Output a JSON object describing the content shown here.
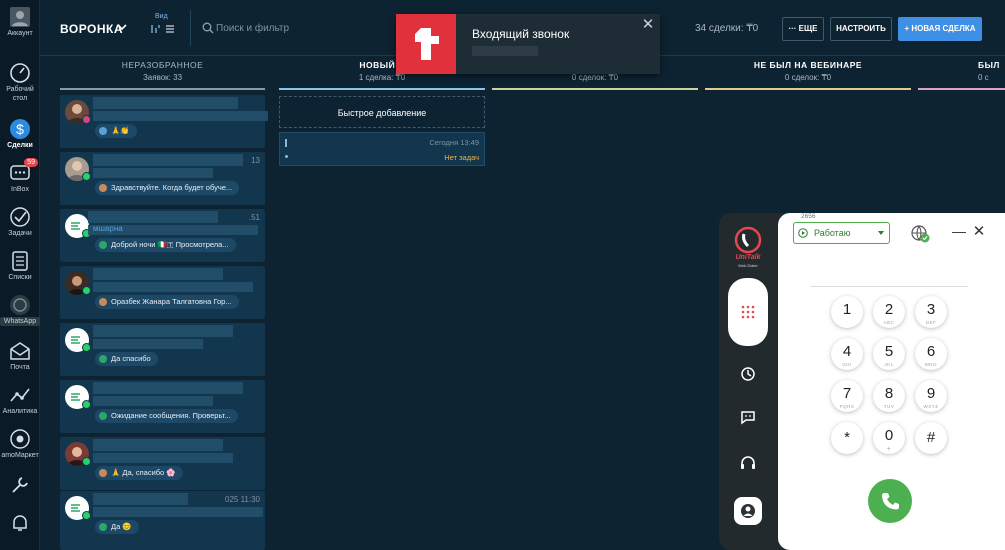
{
  "sidebar": {
    "items": [
      {
        "label": "Аккаунт",
        "icon": "account-icon"
      },
      {
        "label": "Рабочий стол",
        "icon": "dashboard-icon"
      },
      {
        "label": "Сделки",
        "icon": "deals-icon"
      },
      {
        "label": "InBox",
        "icon": "inbox-icon",
        "badge": "59"
      },
      {
        "label": "Задачи",
        "icon": "tasks-icon"
      },
      {
        "label": "Списки",
        "icon": "lists-icon"
      },
      {
        "label": "WhatsApp",
        "icon": "whatsapp-icon"
      },
      {
        "label": "Почта",
        "icon": "mail-icon"
      },
      {
        "label": "Аналитика",
        "icon": "analytics-icon"
      },
      {
        "label": "amoМаркет",
        "icon": "market-icon"
      }
    ]
  },
  "header": {
    "pipeline": "ВОРОНКА",
    "view_label": "Вид",
    "search_placeholder": "Поиск и фильтр",
    "deal_count": "34 сделки: ₸0",
    "more_label": "··· ЕЩЕ",
    "setup_label": "НАСТРОИТЬ",
    "new_deal_label": "+ НОВАЯ СДЕЛКА"
  },
  "columns": [
    {
      "title": "НЕРАЗОБРАННОЕ",
      "sub": "Заявок: 33",
      "color": "#8b9aa6"
    },
    {
      "title": "НОВЫЙ Л",
      "sub": "1 сделка: ₸0",
      "color": "#8cc4ea"
    },
    {
      "title": "",
      "sub": "0 сделок: ₸0",
      "color": "#c9d49a"
    },
    {
      "title": "НЕ БЫЛ НА ВЕБИНАРЕ",
      "sub": "0 сделок: ₸0",
      "color": "#e2c98d"
    },
    {
      "title": "БЫЛ",
      "sub": "0 с",
      "color": "#d6a5c8"
    }
  ],
  "leads": [
    {
      "message": "🙏👏",
      "time": ""
    },
    {
      "message": "Здравствуйте. Когда будет обуче...",
      "time": "13"
    },
    {
      "message": "Доброй ночи 🇮🇹🇹 Просмотрела...",
      "time": ".51",
      "name_fragment": "мшарна"
    },
    {
      "message": "Оразбек Жанара Талгатовна Гор...",
      "time": ""
    },
    {
      "message": "Да спасибо",
      "time": ""
    },
    {
      "message": "Ожидание сообщения. Проверьт...",
      "time": ""
    },
    {
      "message": "🙏 Да, спасибо 🌸",
      "time": ""
    },
    {
      "message": "Да 😊",
      "time": "025 11:30"
    }
  ],
  "new_column": {
    "quick_add": "Быстрое добавление",
    "deal_time": "Сегодня 13:49",
    "deal_task": "Нет задач"
  },
  "notification": {
    "title": "Входящий звонок",
    "close": "✕"
  },
  "dialer": {
    "brand": "UniTalk",
    "brand_sub": "Web Dialer",
    "extension": "2656",
    "status": "Работаю",
    "minimize": "—",
    "close": "✕",
    "keys": [
      {
        "digit": "1",
        "letters": ""
      },
      {
        "digit": "2",
        "letters": "ABC"
      },
      {
        "digit": "3",
        "letters": "DEF"
      },
      {
        "digit": "4",
        "letters": "GHI"
      },
      {
        "digit": "5",
        "letters": "JKL"
      },
      {
        "digit": "6",
        "letters": "MNO"
      },
      {
        "digit": "7",
        "letters": "PQRS"
      },
      {
        "digit": "8",
        "letters": "TUV"
      },
      {
        "digit": "9",
        "letters": "WXYZ"
      },
      {
        "digit": "*",
        "letters": ""
      },
      {
        "digit": "0",
        "letters": "+"
      },
      {
        "digit": "#",
        "letters": ""
      }
    ]
  },
  "colors": {
    "accent": "#3f8fe6",
    "background": "#0d2332",
    "card": "#12364d",
    "notification_brand": "#e1313c",
    "call_green": "#4caf50"
  }
}
